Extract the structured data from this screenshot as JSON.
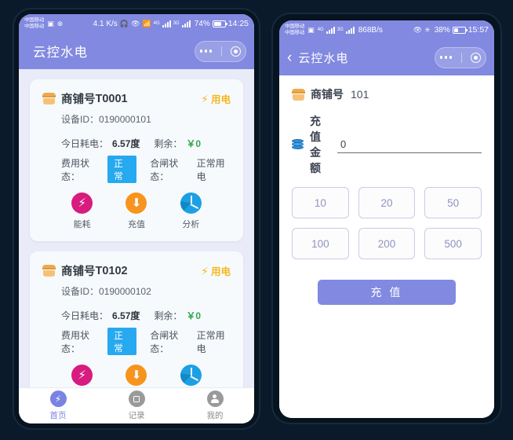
{
  "theme": {
    "page_bg": "#0b1a2b",
    "header_purple": "#8189e0",
    "card_bg": "#f7fafd",
    "badge_blue": "#27a9f0",
    "power_gold": "#f5b820",
    "money_green": "#2fa84f"
  },
  "left_phone": {
    "status": {
      "carrier_line1": "中国移动",
      "carrier_line2": "中国移动",
      "network_speed": "4.1 K/s",
      "battery": "74%",
      "time": "14:25",
      "icons": [
        "headset-icon",
        "eye-icon",
        "wifi-icon",
        "signal-4g-icon",
        "signal-3g-icon",
        "battery-icon"
      ]
    },
    "appbar": {
      "title": "云控水电",
      "capsule": "wechat-capsule"
    },
    "cards": [
      {
        "label": "商铺号",
        "code": "T0001",
        "power_badge": "用电",
        "device_id_label": "设备ID：",
        "device_id": "0190000101",
        "usage_label": "今日耗电：",
        "usage_value": "6.57度",
        "balance_label": "剩余：",
        "balance_value": "￥0",
        "fee_label": "费用状态：",
        "fee_status": "正常",
        "switch_label": "合闸状态：",
        "switch_status": "正常用电",
        "actions": [
          {
            "icon": "lightning-icon",
            "label": "能耗",
            "color": "#d81b7e"
          },
          {
            "icon": "download-arrow-icon",
            "label": "充值",
            "color": "#f7941e"
          },
          {
            "icon": "pie-chart-icon",
            "label": "分析",
            "color": "#1ca0e3"
          }
        ]
      },
      {
        "label": "商铺号",
        "code": "T0102",
        "power_badge": "用电",
        "device_id_label": "设备ID：",
        "device_id": "0190000102",
        "usage_label": "今日耗电：",
        "usage_value": "6.57度",
        "balance_label": "剩余：",
        "balance_value": "￥0",
        "fee_label": "费用状态：",
        "fee_status": "正常",
        "switch_label": "合闸状态：",
        "switch_status": "正常用电",
        "actions": [
          {
            "icon": "lightning-icon",
            "label": "",
            "color": "#d81b7e"
          },
          {
            "icon": "download-arrow-icon",
            "label": "",
            "color": "#f7941e"
          },
          {
            "icon": "pie-chart-icon",
            "label": "",
            "color": "#1ca0e3"
          }
        ]
      }
    ],
    "tabbar": [
      {
        "icon": "lightning-icon",
        "label": "首页",
        "active": true
      },
      {
        "icon": "record-icon",
        "label": "记录",
        "active": false
      },
      {
        "icon": "person-icon",
        "label": "我的",
        "active": false
      }
    ]
  },
  "right_phone": {
    "status": {
      "carrier_line1": "中国移动",
      "carrier_line2": "中国移动",
      "network_speed": "868B/s",
      "battery": "38%",
      "time": "15:57",
      "icons": [
        "signal-4g-icon",
        "signal-3g-icon",
        "eye-icon",
        "bluetooth-icon",
        "battery-icon"
      ]
    },
    "appbar": {
      "back": "‹",
      "title": "云控水电",
      "capsule": "wechat-capsule"
    },
    "form": {
      "shop_label": "商铺号",
      "shop_value": "101",
      "amount_label": "充值金额",
      "amount_value": "0",
      "amount_placeholder": "0"
    },
    "quick_amounts": [
      "10",
      "20",
      "50",
      "100",
      "200",
      "500"
    ],
    "submit_label": "充 值"
  }
}
